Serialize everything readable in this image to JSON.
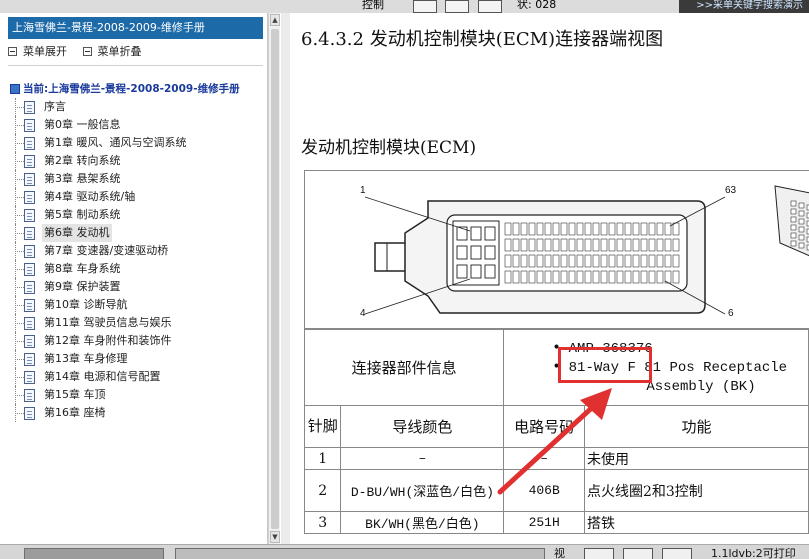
{
  "toolbar": {
    "left_text": "控制",
    "line_label": "状: 028",
    "banner_text": ">>采单关键字搜索演示"
  },
  "sidebar": {
    "title": "上海雪佛兰-景程-2008-2009-维修手册",
    "expand_label": "菜单展开",
    "collapse_label": "菜单折叠",
    "root_label": "当前:上海雪佛兰-景程-2008-2009-维修手册",
    "items": [
      {
        "label": "序言"
      },
      {
        "label": "第0章 一般信息"
      },
      {
        "label": "第1章 暖风、通风与空调系统"
      },
      {
        "label": "第2章 转向系统"
      },
      {
        "label": "第3章 悬架系统"
      },
      {
        "label": "第4章 驱动系统/轴"
      },
      {
        "label": "第5章 制动系统"
      },
      {
        "label": "第6章 发动机"
      },
      {
        "label": "第7章 变速器/变速驱动桥"
      },
      {
        "label": "第8章 车身系统"
      },
      {
        "label": "第9章 保护装置"
      },
      {
        "label": "第10章 诊断导航"
      },
      {
        "label": "第11章 驾驶员信息与娱乐"
      },
      {
        "label": "第12章 车身附件和装饰件"
      },
      {
        "label": "第13章 车身修理"
      },
      {
        "label": "第14章 电源和信号配置"
      },
      {
        "label": "第15章 车顶"
      },
      {
        "label": "第16章 座椅"
      }
    ],
    "selected_index": 7
  },
  "content": {
    "heading": "6.4.3.2 发动机控制模块(ECM)连接器端视图",
    "subheading": "发动机控制模块(ECM)",
    "diagram_pin_labels": [
      "1",
      "63",
      "4",
      "6"
    ],
    "info_label": "连接器部件信息",
    "info_items": [
      {
        "bullet": "•",
        "text": "AMP 368376"
      },
      {
        "bullet": "•",
        "text": "81-Way F 81 Pos Receptacle"
      },
      {
        "bullet": "",
        "text": "Assembly  (BK)"
      }
    ],
    "table_headers": {
      "pin": "针脚",
      "wire_color": "导线颜色",
      "circuit": "电路号码",
      "function": "功能"
    },
    "rows": [
      {
        "pin": "1",
        "wire_color": "–",
        "circuit": "–",
        "function": "未使用"
      },
      {
        "pin": "2",
        "wire_color": "D-BU/WH(深蓝色/白色)",
        "circuit": "406B",
        "function": "点火线圈2和3控制"
      },
      {
        "pin": "3",
        "wire_color": "BK/WH(黑色/白色)",
        "circuit": "251H",
        "function": "搭铁"
      }
    ]
  },
  "status": {
    "view_label": "视",
    "page_label": "1.1ldvb:2可打印"
  },
  "colors": {
    "sidebar_title_bg": "#1d6aa9",
    "highlight_border": "#e03030",
    "tree_root_text": "#1a3a9c"
  }
}
